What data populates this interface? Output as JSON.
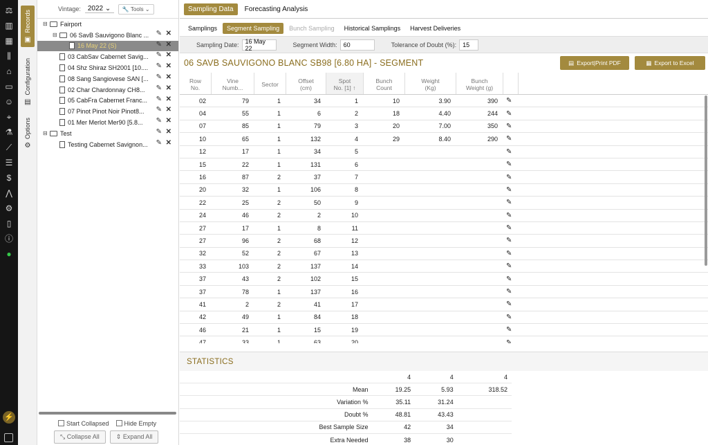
{
  "iconbar": [
    "scale-icon",
    "calendar-icon",
    "grid-calendar-icon",
    "columns-icon",
    "barn-icon",
    "vat-icon",
    "people-icon",
    "map-pin-icon",
    "flask-icon",
    "graph-icon",
    "checklist-icon",
    "money-icon",
    "compass-icon",
    "gear-icon",
    "tablet-icon",
    "info-icon",
    "chat-icon"
  ],
  "vtabs": {
    "records": "Records",
    "configuration": "Configuration",
    "options": "Options"
  },
  "tree": {
    "vintage_label": "Vintage:",
    "vintage_value": "2022",
    "tools_label": "Tools",
    "items": [
      {
        "label": "Fairport",
        "level": 0,
        "type": "folder",
        "actions": false,
        "sel": false
      },
      {
        "label": "06 SavB Sauvigono Blanc ...",
        "level": 1,
        "type": "folder",
        "actions": true,
        "sel": false
      },
      {
        "label": "16 May 22 (S)",
        "level": 2,
        "type": "file",
        "actions": true,
        "sel": true
      },
      {
        "label": "03 CabSav Cabernet Savig...",
        "level": 1,
        "type": "file",
        "actions": true,
        "sel": false
      },
      {
        "label": "04 Shz Shiraz SH2001 [10....",
        "level": 1,
        "type": "file",
        "actions": true,
        "sel": false
      },
      {
        "label": "08 Sang Sangiovese SAN [...",
        "level": 1,
        "type": "file",
        "actions": true,
        "sel": false
      },
      {
        "label": "02 Char Chardonnay CH8...",
        "level": 1,
        "type": "file",
        "actions": true,
        "sel": false
      },
      {
        "label": "05 CabFra Cabernet Franc...",
        "level": 1,
        "type": "file",
        "actions": true,
        "sel": false
      },
      {
        "label": "07 Pinot Pinot Noir Pinot8...",
        "level": 1,
        "type": "file",
        "actions": true,
        "sel": false
      },
      {
        "label": "01 Mer Merlot Mer90 [5.8...",
        "level": 1,
        "type": "file",
        "actions": true,
        "sel": false
      },
      {
        "label": "Test",
        "level": 0,
        "type": "folder",
        "actions": true,
        "sel": false
      },
      {
        "label": "Testing Cabernet Savignon...",
        "level": 1,
        "type": "file",
        "actions": true,
        "sel": false
      }
    ],
    "start_collapsed": "Start Collapsed",
    "hide_empty": "Hide Empty",
    "collapse_all": "Collapse All",
    "expand_all": "Expand All"
  },
  "main_tabs": [
    {
      "label": "Sampling Data",
      "on": true
    },
    {
      "label": "Forecasting Analysis",
      "on": false
    }
  ],
  "sub_tabs": [
    {
      "label": "Samplings",
      "state": ""
    },
    {
      "label": "Segment Sampling",
      "state": "on"
    },
    {
      "label": "Bunch Sampling",
      "state": "dis"
    },
    {
      "label": "Historical Samplings",
      "state": ""
    },
    {
      "label": "Harvest Deliveries",
      "state": ""
    }
  ],
  "params": {
    "date_label": "Sampling Date:",
    "date_value": "16 May 22",
    "width_label": "Segment Width:",
    "width_value": "60",
    "tol_label": "Tolerance of Doubt (%):",
    "tol_value": "15"
  },
  "heading": "06 SAVB SAUVIGONO BLANC SB98 [6.80 HA] - SEGMENT",
  "export_pdf": "Export|Print PDF",
  "export_excel": "Export to Excel",
  "table": {
    "headers": [
      [
        "Row",
        "No."
      ],
      [
        "Vine",
        "Numb..."
      ],
      [
        "Sector",
        ""
      ],
      [
        "Offset",
        "(cm)"
      ],
      [
        "Spot",
        "No. [1] ↑"
      ],
      [
        "Bunch",
        "Count"
      ],
      [
        "Weight",
        "(Kg)"
      ],
      [
        "Bunch",
        "Weight (g)"
      ]
    ],
    "rows": [
      [
        "02",
        "79",
        "1",
        "34",
        "1",
        "10",
        "3.90",
        "390"
      ],
      [
        "04",
        "55",
        "1",
        "6",
        "2",
        "18",
        "4.40",
        "244"
      ],
      [
        "07",
        "85",
        "1",
        "79",
        "3",
        "20",
        "7.00",
        "350"
      ],
      [
        "10",
        "65",
        "1",
        "132",
        "4",
        "29",
        "8.40",
        "290"
      ],
      [
        "12",
        "17",
        "1",
        "34",
        "5",
        "",
        "",
        ""
      ],
      [
        "15",
        "22",
        "1",
        "131",
        "6",
        "",
        "",
        ""
      ],
      [
        "16",
        "87",
        "2",
        "37",
        "7",
        "",
        "",
        ""
      ],
      [
        "20",
        "32",
        "1",
        "106",
        "8",
        "",
        "",
        ""
      ],
      [
        "22",
        "25",
        "2",
        "50",
        "9",
        "",
        "",
        ""
      ],
      [
        "24",
        "46",
        "2",
        "2",
        "10",
        "",
        "",
        ""
      ],
      [
        "27",
        "17",
        "1",
        "8",
        "11",
        "",
        "",
        ""
      ],
      [
        "27",
        "96",
        "2",
        "68",
        "12",
        "",
        "",
        ""
      ],
      [
        "32",
        "52",
        "2",
        "67",
        "13",
        "",
        "",
        ""
      ],
      [
        "33",
        "103",
        "2",
        "137",
        "14",
        "",
        "",
        ""
      ],
      [
        "37",
        "43",
        "2",
        "102",
        "15",
        "",
        "",
        ""
      ],
      [
        "37",
        "78",
        "1",
        "137",
        "16",
        "",
        "",
        ""
      ],
      [
        "41",
        "2",
        "2",
        "41",
        "17",
        "",
        "",
        ""
      ],
      [
        "42",
        "49",
        "1",
        "84",
        "18",
        "",
        "",
        ""
      ],
      [
        "46",
        "21",
        "1",
        "15",
        "19",
        "",
        "",
        ""
      ],
      [
        "47",
        "33",
        "1",
        "63",
        "20",
        "",
        "",
        ""
      ]
    ]
  },
  "stats": {
    "title": "STATISTICS",
    "rows": [
      {
        "label": "",
        "a": "4",
        "b": "4",
        "c": "4"
      },
      {
        "label": "Mean",
        "a": "19.25",
        "b": "5.93",
        "c": "318.52"
      },
      {
        "label": "Variation %",
        "a": "35.11",
        "b": "31.24",
        "c": ""
      },
      {
        "label": "Doubt %",
        "a": "48.81",
        "b": "43.43",
        "c": ""
      },
      {
        "label": "Best Sample Size",
        "a": "42",
        "b": "34",
        "c": ""
      },
      {
        "label": "Extra Needed",
        "a": "38",
        "b": "30",
        "c": ""
      }
    ]
  }
}
